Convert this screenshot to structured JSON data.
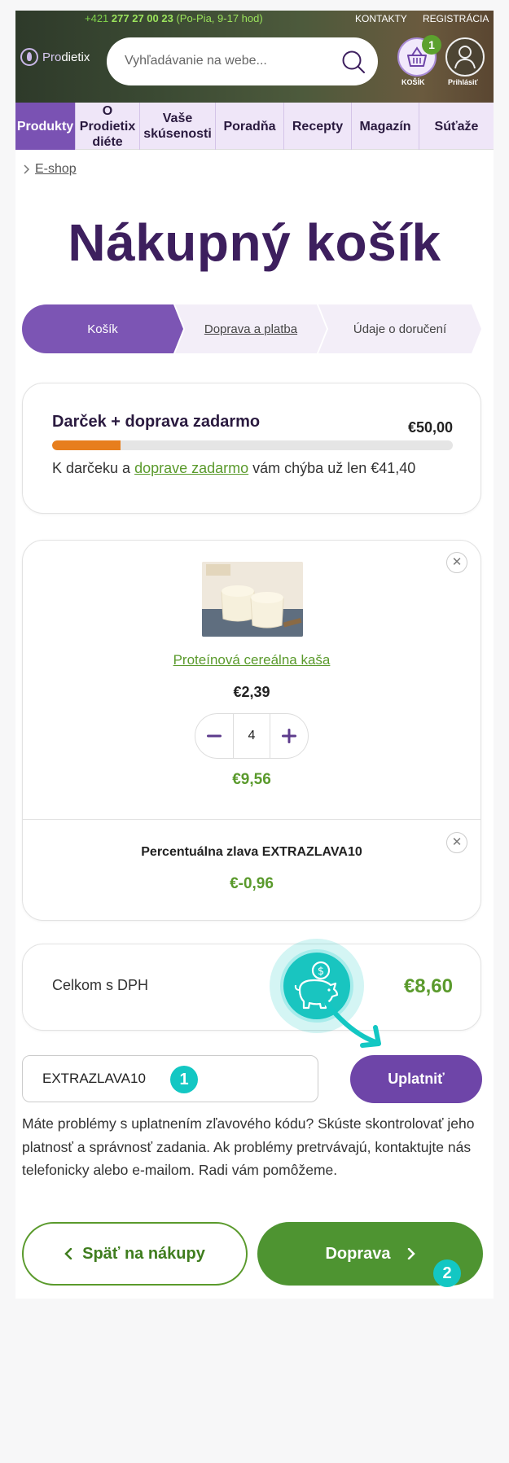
{
  "header": {
    "phone_prefix": "+421",
    "phone_number": "277 27 00 23",
    "hours": "(Po-Pia, 9-17 hod)",
    "contacts": "KONTAKTY",
    "register": "REGISTRÁCIA",
    "logo_pro": "Pro",
    "logo_rest": "dietix",
    "search_placeholder": "Vyhľadávanie na webe...",
    "cart_count": "1",
    "cart_label": "KOŠÍK",
    "login_label": "Prihlásiť"
  },
  "nav": {
    "items": [
      {
        "label": "Produkty"
      },
      {
        "label": "O Prodietix diéte"
      },
      {
        "label": "Vaše skúsenosti"
      },
      {
        "label": "Poradňa"
      },
      {
        "label": "Recepty"
      },
      {
        "label": "Magazín"
      },
      {
        "label": "Súťaže"
      }
    ]
  },
  "breadcrumb": {
    "item": "E-shop"
  },
  "page_title": "Nákupný košík",
  "steps": [
    "Košík",
    "Doprava a platba",
    "Údaje o doručení"
  ],
  "gift": {
    "title": "Darček + doprava zadarmo",
    "threshold": "€50,00",
    "progress": 0.17,
    "text_before": "K darčeku a ",
    "link": "doprave zadarmo",
    "text_after": " vám chýba už len €41,40"
  },
  "item": {
    "name": "Proteínová cereálna kaša",
    "unit_price": "€2,39",
    "quantity": "4",
    "total": "€9,56"
  },
  "discount": {
    "name": "Percentuálna zlava EXTRAZLAVA10",
    "amount": "€-0,96"
  },
  "total": {
    "label": "Celkom s DPH",
    "amount": "€8,60"
  },
  "coupon": {
    "value": "EXTRAZLAVA10",
    "apply_label": "Uplatniť"
  },
  "help_text": "Máte problémy s uplatnením zľavového kódu? Skúste skontrolovať jeho platnosť a správnosť zadania. Ak problémy pretrvávajú, kontaktujte nás telefonicky alebo e-mailom. Radi vám pomôžeme.",
  "buttons": {
    "back": "Späť na nákupy",
    "next": "Doprava"
  },
  "markers": [
    "1",
    "2"
  ],
  "colors": {
    "brand_purple": "#6e45a8",
    "title_purple": "#3d1f5e",
    "green": "#5a9a2c",
    "progress_orange": "#e77e1d",
    "marker_teal": "#13c7c3"
  }
}
